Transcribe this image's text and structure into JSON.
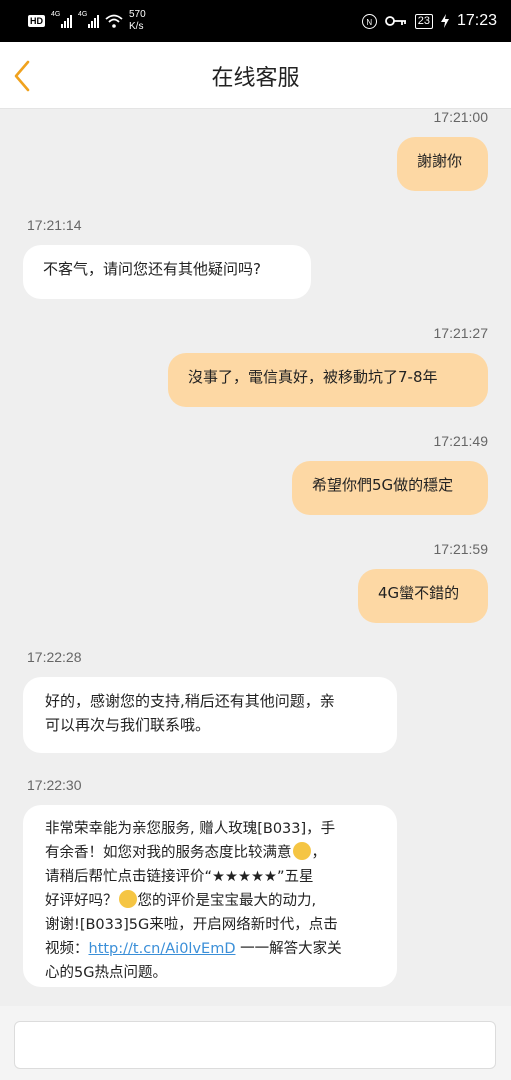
{
  "status_bar": {
    "hd_label": "HD",
    "hd_sub": "2",
    "net1": "4G",
    "net2": "4G",
    "speed_value": "570",
    "speed_unit": "K/s",
    "battery": "23",
    "time": "17:23",
    "icons": [
      "signal-icon",
      "wifi-icon",
      "nfc-icon",
      "key-icon",
      "battery-icon",
      "charging-icon"
    ]
  },
  "header": {
    "title": "在线客服",
    "back_icon": "chevron-left-icon",
    "accent": "#f0a21e"
  },
  "messages": [
    {
      "side": "me",
      "time": "17:21:00",
      "text": "謝謝你"
    },
    {
      "side": "bot",
      "time": "17:21:14",
      "text": "不客气，请问您还有其他疑问吗?"
    },
    {
      "side": "me",
      "time": "17:21:27",
      "text": "沒事了，電信真好，被移動坑了7-8年"
    },
    {
      "side": "me",
      "time": "17:21:49",
      "text": "希望你們5G做的穩定"
    },
    {
      "side": "me",
      "time": "17:21:59",
      "text": "4G蠻不錯的"
    },
    {
      "side": "bot",
      "time": "17:22:28",
      "line1": "好的，感谢您的支持,稍后还有其他问题，亲",
      "line2": "可以再次与我们联系哦。"
    },
    {
      "side": "bot",
      "time": "17:22:30",
      "line1": "非常荣幸能为亲您服务, 赠人玫瑰[B033]，手",
      "line2": "有余香！如您对我的服务态度比较满意",
      "line3": "，",
      "line4": "请稍后帮忙点击链接评价“★★★★★”五星",
      "line5a": "好评好吗？",
      "line5b": "您的评价是宝宝最大的动力,",
      "line6": "谢谢![B033]5G来啦，开启网络新时代，点击",
      "line7a": "视频：",
      "link": "http://t.cn/Ai0lvEmD",
      "line7b": " 一一解答大家关",
      "line8": "心的5G热点问题。"
    }
  ],
  "colors": {
    "my_bubble": "#fdd8a4",
    "bot_bubble": "#ffffff",
    "background": "#efefef",
    "link": "#3b8fd8"
  },
  "input": {
    "placeholder": "",
    "value": ""
  }
}
